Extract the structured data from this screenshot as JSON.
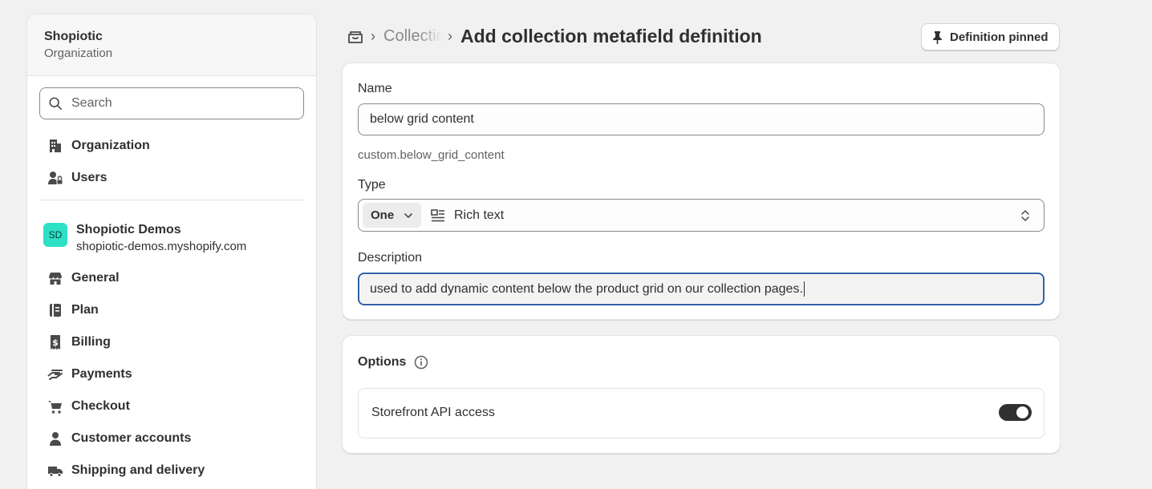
{
  "sidebar": {
    "org_name": "Shopiotic",
    "org_sub": "Organization",
    "search_placeholder": "Search",
    "top_items": [
      {
        "label": "Organization",
        "icon": "building-icon"
      },
      {
        "label": "Users",
        "icon": "users-icon"
      }
    ],
    "store": {
      "avatar": "SD",
      "name": "Shopiotic Demos",
      "url": "shopiotic-demos.myshopify.com",
      "avatar_color": "#2ee0c6"
    },
    "items": [
      {
        "label": "General",
        "icon": "store-icon"
      },
      {
        "label": "Plan",
        "icon": "plan-icon"
      },
      {
        "label": "Billing",
        "icon": "billing-icon"
      },
      {
        "label": "Payments",
        "icon": "payments-icon"
      },
      {
        "label": "Checkout",
        "icon": "cart-icon"
      },
      {
        "label": "Customer accounts",
        "icon": "person-icon"
      },
      {
        "label": "Shipping and delivery",
        "icon": "truck-icon"
      }
    ]
  },
  "header": {
    "breadcrumb_link": "Collections",
    "title": "Add collection metafield definition",
    "pin_button": "Definition pinned"
  },
  "form": {
    "name_label": "Name",
    "name_value": "below grid content",
    "namespace_key": "custom.below_grid_content",
    "type_label": "Type",
    "type_list": "One",
    "type_value": "Rich text",
    "description_label": "Description",
    "description_value": "used to add dynamic content below the product grid on our collection pages."
  },
  "options": {
    "title": "Options",
    "storefront_label": "Storefront API access",
    "storefront_enabled": true
  },
  "colors": {
    "focus": "#2f5fa6",
    "toggle_on": "#303030",
    "background": "#f1f1f1"
  }
}
